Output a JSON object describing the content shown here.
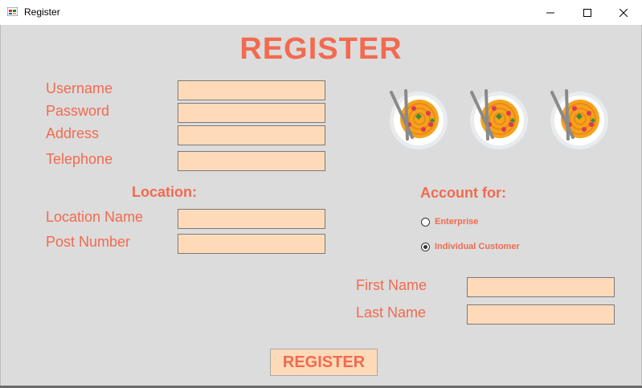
{
  "window": {
    "title": "Register",
    "minimize_icon": "minimize-icon",
    "maximize_icon": "maximize-icon",
    "close_icon": "close-icon"
  },
  "form": {
    "heading": "REGISTER",
    "labels": {
      "username": "Username",
      "password": "Password",
      "address": "Address",
      "telephone": "Telephone",
      "location_section": "Location:",
      "location_name": "Location Name",
      "post_number": "Post Number",
      "account_section": "Account for:",
      "first_name": "First Name",
      "last_name": "Last Name"
    },
    "fields": {
      "username": "",
      "password": "",
      "address": "",
      "telephone": "",
      "location_name": "",
      "post_number": "",
      "first_name": "",
      "last_name": ""
    },
    "account_options": [
      {
        "label": "Enterprise",
        "selected": false
      },
      {
        "label": "Individual Customer",
        "selected": true
      }
    ],
    "submit_label": "REGISTER",
    "images": [
      "noodle-bowl-icon",
      "noodle-bowl-icon",
      "noodle-bowl-icon"
    ]
  },
  "colors": {
    "accent": "#f26a4f",
    "field_bg": "#ffdab9",
    "form_bg": "#dcdcdc"
  }
}
